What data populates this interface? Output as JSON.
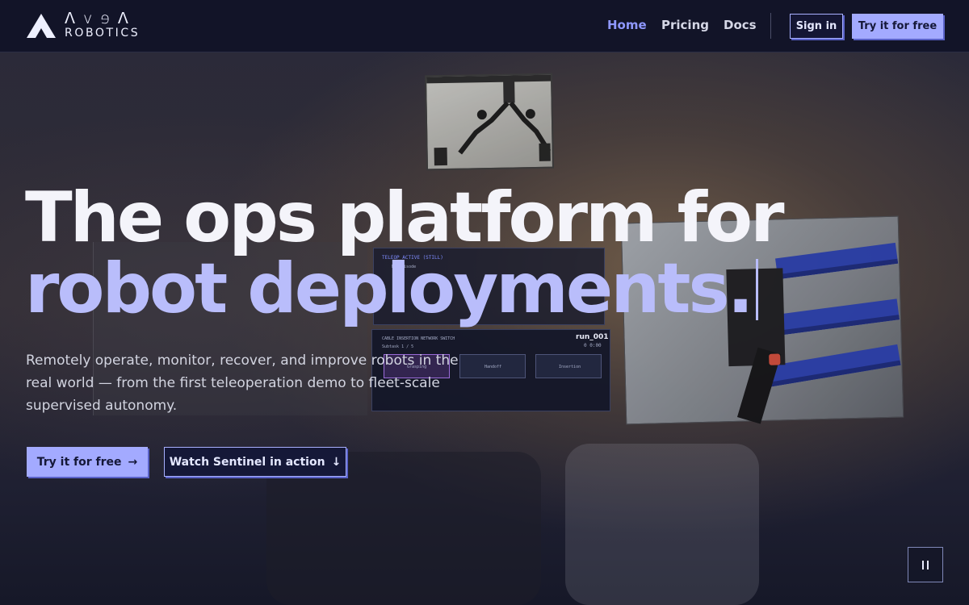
{
  "brand": {
    "name": "AVEA",
    "wordmark_top": "ᐱvɘᐱ",
    "wordmark_bottom": "ROBOTICS"
  },
  "nav": {
    "links": [
      {
        "label": "Home",
        "active": true
      },
      {
        "label": "Pricing",
        "active": false
      },
      {
        "label": "Docs",
        "active": false
      }
    ],
    "sign_in_label": "Sign in",
    "try_label": "Try it for free"
  },
  "hero": {
    "headline_line1": "The ops platform for",
    "headline_line2": "robot deployments.",
    "subtext": "Remotely operate, monitor, recover, and improve robots in the real world — from the first teleoperation demo to fleet-scale supervised autonomy.",
    "cta_primary_label": "Try it for free",
    "cta_primary_arrow": "→",
    "cta_secondary_label": "Watch Sentinel in action",
    "cta_secondary_arrow": "↓"
  },
  "video_panel": {
    "status_title": "TELEOP ACTIVE (STILL)",
    "status_sub": "No Episode",
    "task_title": "CABLE INSERTION NETWORK SWITCH",
    "task_sub": "Subtask 1 / 5",
    "run_id": "run_001",
    "run_time": "0 0:00",
    "steps": [
      "Grasping",
      "Handoff",
      "Insertion"
    ]
  },
  "media_controls": {
    "pause_icon": "pause-icon"
  },
  "colors": {
    "accent": "#a3aaff",
    "accent_text": "#8f98ff",
    "headline_highlight": "#b9bdfb",
    "nav_bg": "#121428"
  }
}
